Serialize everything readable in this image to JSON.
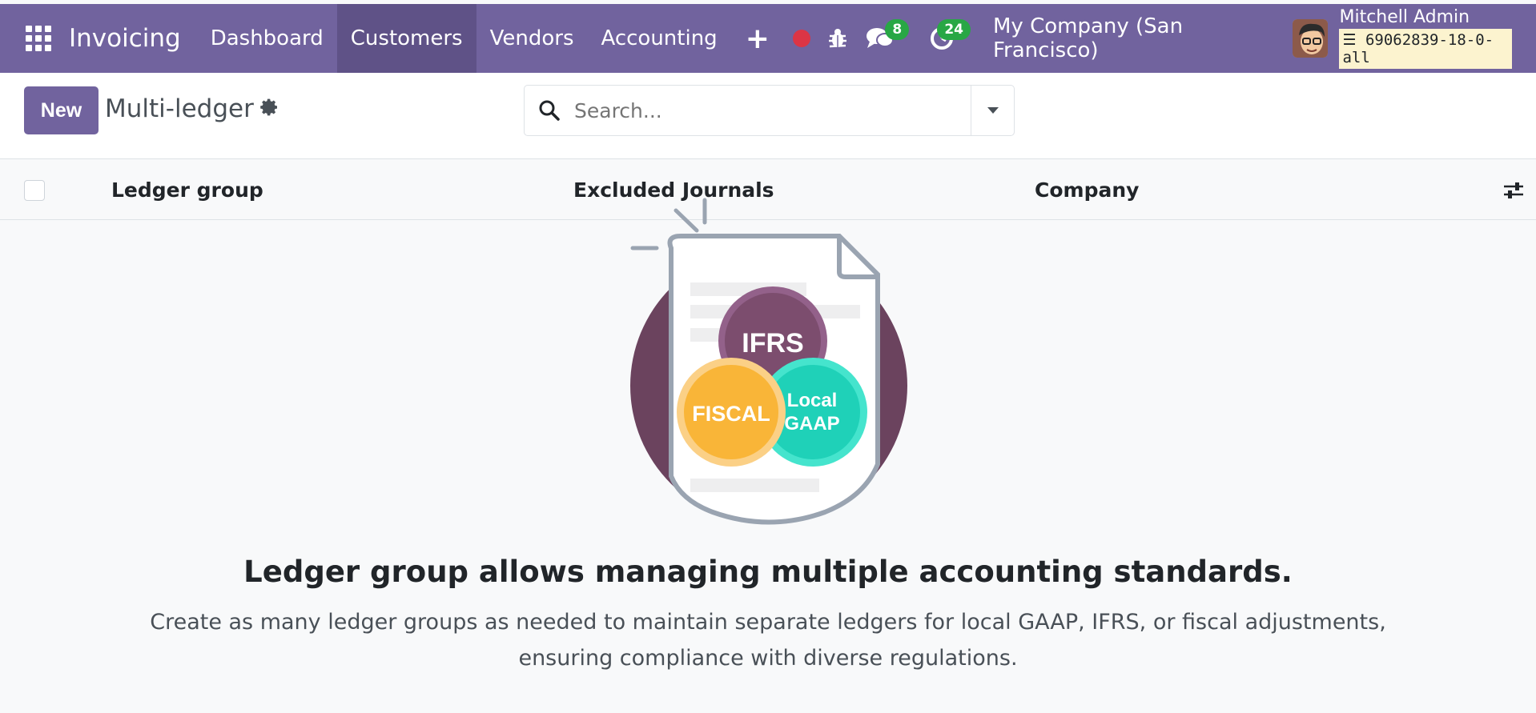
{
  "app": {
    "name": "Invoicing"
  },
  "nav": {
    "items": [
      {
        "label": "Dashboard",
        "active": false
      },
      {
        "label": "Customers",
        "active": true
      },
      {
        "label": "Vendors",
        "active": false
      },
      {
        "label": "Accounting",
        "active": false
      }
    ],
    "plus_label": "+"
  },
  "systray": {
    "messages_count": "8",
    "activities_count": "24",
    "company": "My Company (San Francisco)",
    "user_name": "Mitchell Admin",
    "database": "69062839-18-0-all"
  },
  "control_panel": {
    "new_label": "New",
    "breadcrumb": "Multi-ledger",
    "search_placeholder": "Search..."
  },
  "table": {
    "columns": [
      "Ledger group",
      "Excluded Journals",
      "Company"
    ]
  },
  "illustration": {
    "circles": [
      "IFRS",
      "FISCAL",
      "Local",
      "GAAP"
    ]
  },
  "empty_state": {
    "title": "Ledger group allows managing multiple accounting standards.",
    "description": "Create as many ledger groups as needed to maintain separate ledgers for local GAAP, IFRS, or fiscal adjustments, ensuring compliance with diverse regulations."
  },
  "colors": {
    "brand": "#71639e",
    "brand_active": "#5f5287",
    "badge": "#28a745",
    "record": "#dc3545",
    "ifrs": "#7c4d6e",
    "fiscal": "#f9b538",
    "gaap": "#1fd1b8"
  },
  "icons": [
    "apps-grid-icon",
    "record-icon",
    "bug-icon",
    "chat-icon",
    "clock-icon",
    "gear-icon",
    "search-icon",
    "caret-down-icon",
    "column-settings-icon"
  ]
}
